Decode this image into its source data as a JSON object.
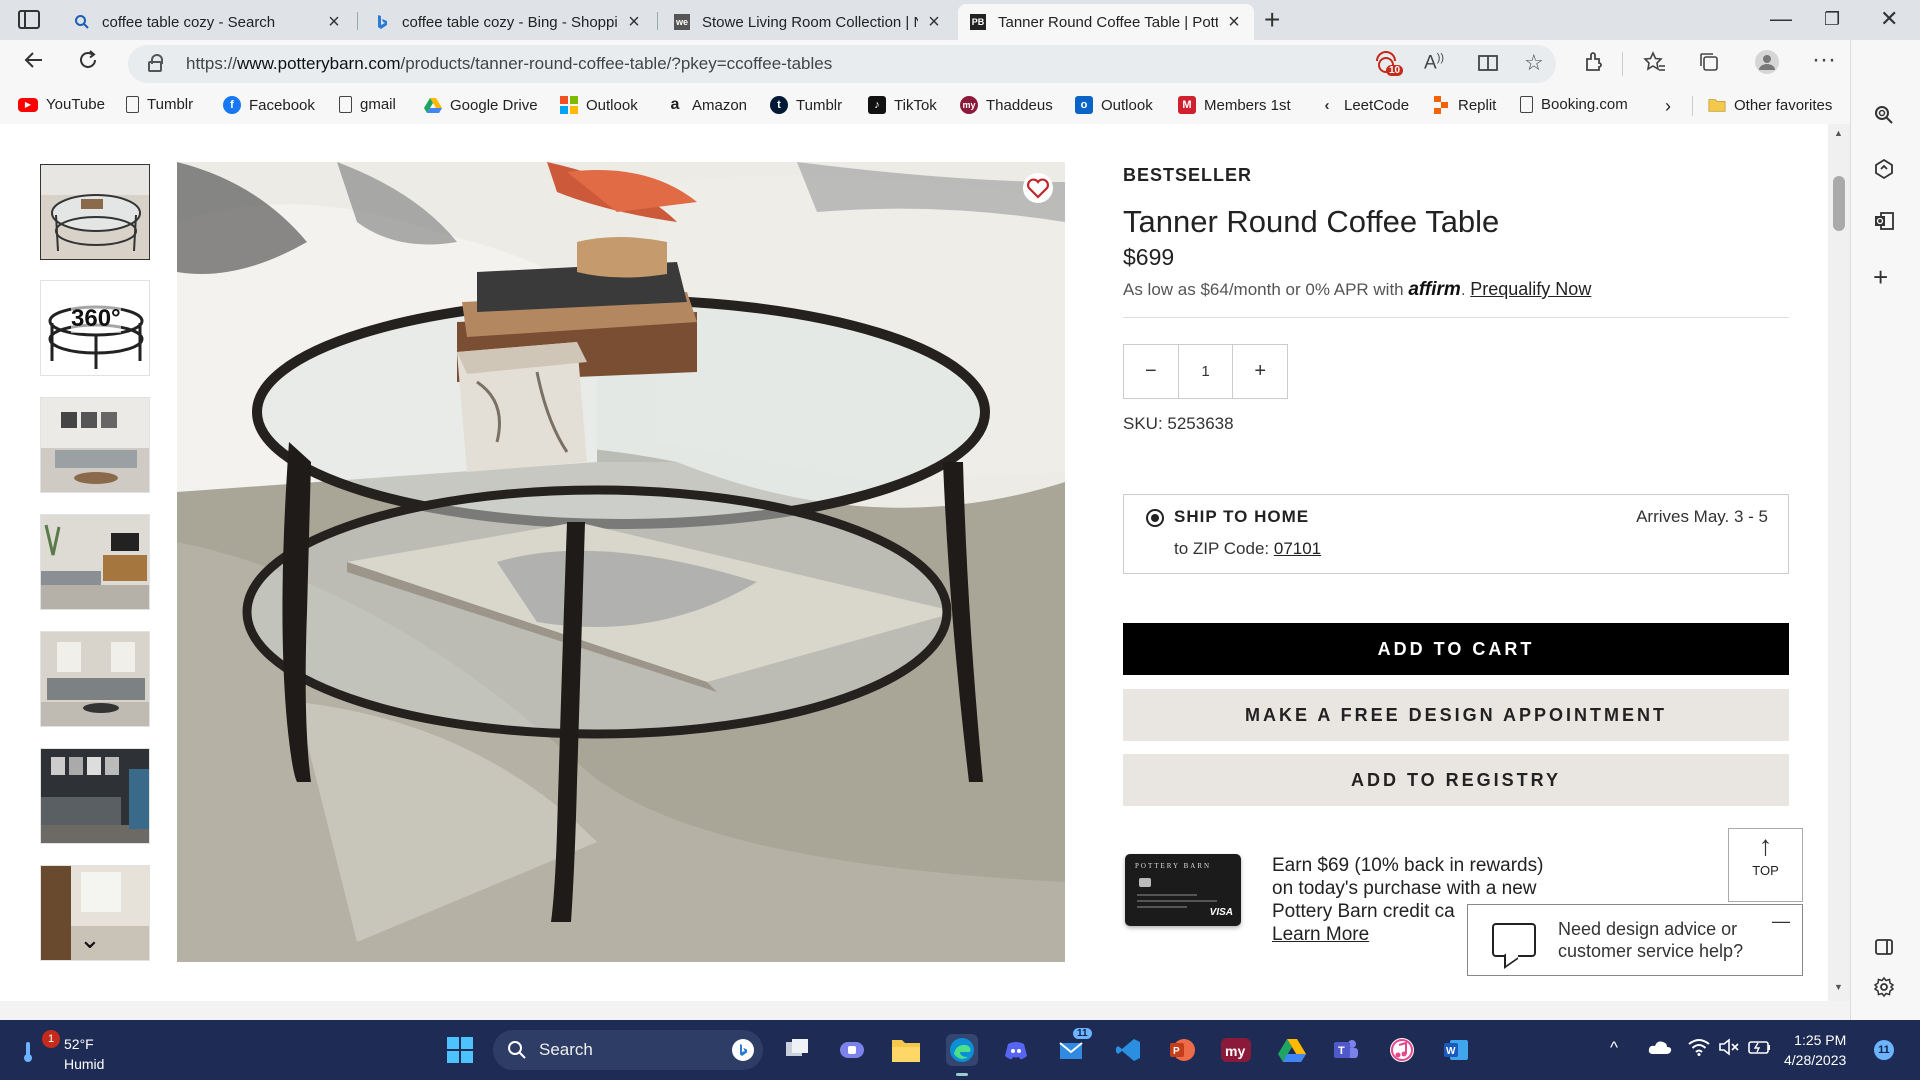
{
  "browser": {
    "tabs": [
      {
        "title": "coffee table cozy - Search",
        "favicon": "search-icon"
      },
      {
        "title": "coffee table cozy - Bing - Shoppi",
        "favicon": "bing-icon"
      },
      {
        "title": "Stowe Living Room Collection | N",
        "favicon": "we-icon"
      },
      {
        "title": "Tanner Round Coffee Table | Pott",
        "favicon": "pottery-barn-icon"
      }
    ],
    "url_prefix": "https://",
    "url_domain": "www.potterybarn.com",
    "url_path": "/products/tanner-round-coffee-table/?pkey=ccoffee-tables",
    "tracking_badge": "10",
    "bookmarks": [
      {
        "label": "YouTube",
        "icon": "youtube-icon",
        "color": "#ff0000"
      },
      {
        "label": "Tumblr",
        "icon": "page-icon",
        "color": ""
      },
      {
        "label": "Facebook",
        "icon": "facebook-icon",
        "color": "#1877f2"
      },
      {
        "label": "gmail",
        "icon": "page-icon",
        "color": ""
      },
      {
        "label": "Google Drive",
        "icon": "google-drive-icon",
        "color": "#1fa463"
      },
      {
        "label": "Outlook",
        "icon": "microsoft-icon",
        "color": "#f25022"
      },
      {
        "label": "Amazon",
        "icon": "amazon-icon",
        "color": "#222222"
      },
      {
        "label": "Tumblr",
        "icon": "tumblr-icon",
        "color": "#001935"
      },
      {
        "label": "TikTok",
        "icon": "tiktok-icon",
        "color": "#111111"
      },
      {
        "label": "Thaddeus",
        "icon": "my-icon",
        "color": "#8b1a3a"
      },
      {
        "label": "Outlook",
        "icon": "outlook-icon",
        "color": "#0a64c8"
      },
      {
        "label": "Members 1st",
        "icon": "members-icon",
        "color": "#d0202e"
      },
      {
        "label": "LeetCode",
        "icon": "leetcode-icon",
        "color": "#333333"
      },
      {
        "label": "Replit",
        "icon": "replit-icon",
        "color": "#f26207"
      },
      {
        "label": "Booking.com",
        "icon": "page-icon",
        "color": ""
      }
    ],
    "other_favorites": "Other favorites"
  },
  "product": {
    "badge": "BESTSELLER",
    "title": "Tanner Round Coffee Table",
    "price": "$699",
    "financing_text": "As low as $64/month or 0% APR with ",
    "affirm_brand": "affirm",
    "prequalify_link": "Prequalify Now",
    "qty_minus": "−",
    "quantity": "1",
    "qty_plus": "+",
    "sku": "SKU: 5253638",
    "ship_heading": "SHIP TO HOME",
    "ship_zip_label": "to ZIP Code: ",
    "ship_zip": "07101",
    "ship_arrival": "Arrives May. 3 - 5",
    "add_to_cart": "ADD TO CART",
    "design_appointment": "MAKE A FREE DESIGN APPOINTMENT",
    "add_to_registry": "ADD TO REGISTRY",
    "rewards_line1": "Earn $69 (10% back in rewards)",
    "rewards_line2": "on today's purchase with a new",
    "rewards_line3": "Pottery Barn credit ca",
    "rewards_link": "Learn More",
    "card_brand": "POTTERY BARN",
    "card_network": "VISA",
    "thumb_360": "360°",
    "top_label": "TOP",
    "chat_text_1": "Need design advice or",
    "chat_text_2": "customer service help?"
  },
  "taskbar": {
    "weather_temp": "52°F",
    "weather_desc": "Humid",
    "weather_badge": "1",
    "search_label": "Search",
    "mail_badge": "11",
    "time": "1:25 PM",
    "date": "4/28/2023",
    "notif_count": "11"
  }
}
